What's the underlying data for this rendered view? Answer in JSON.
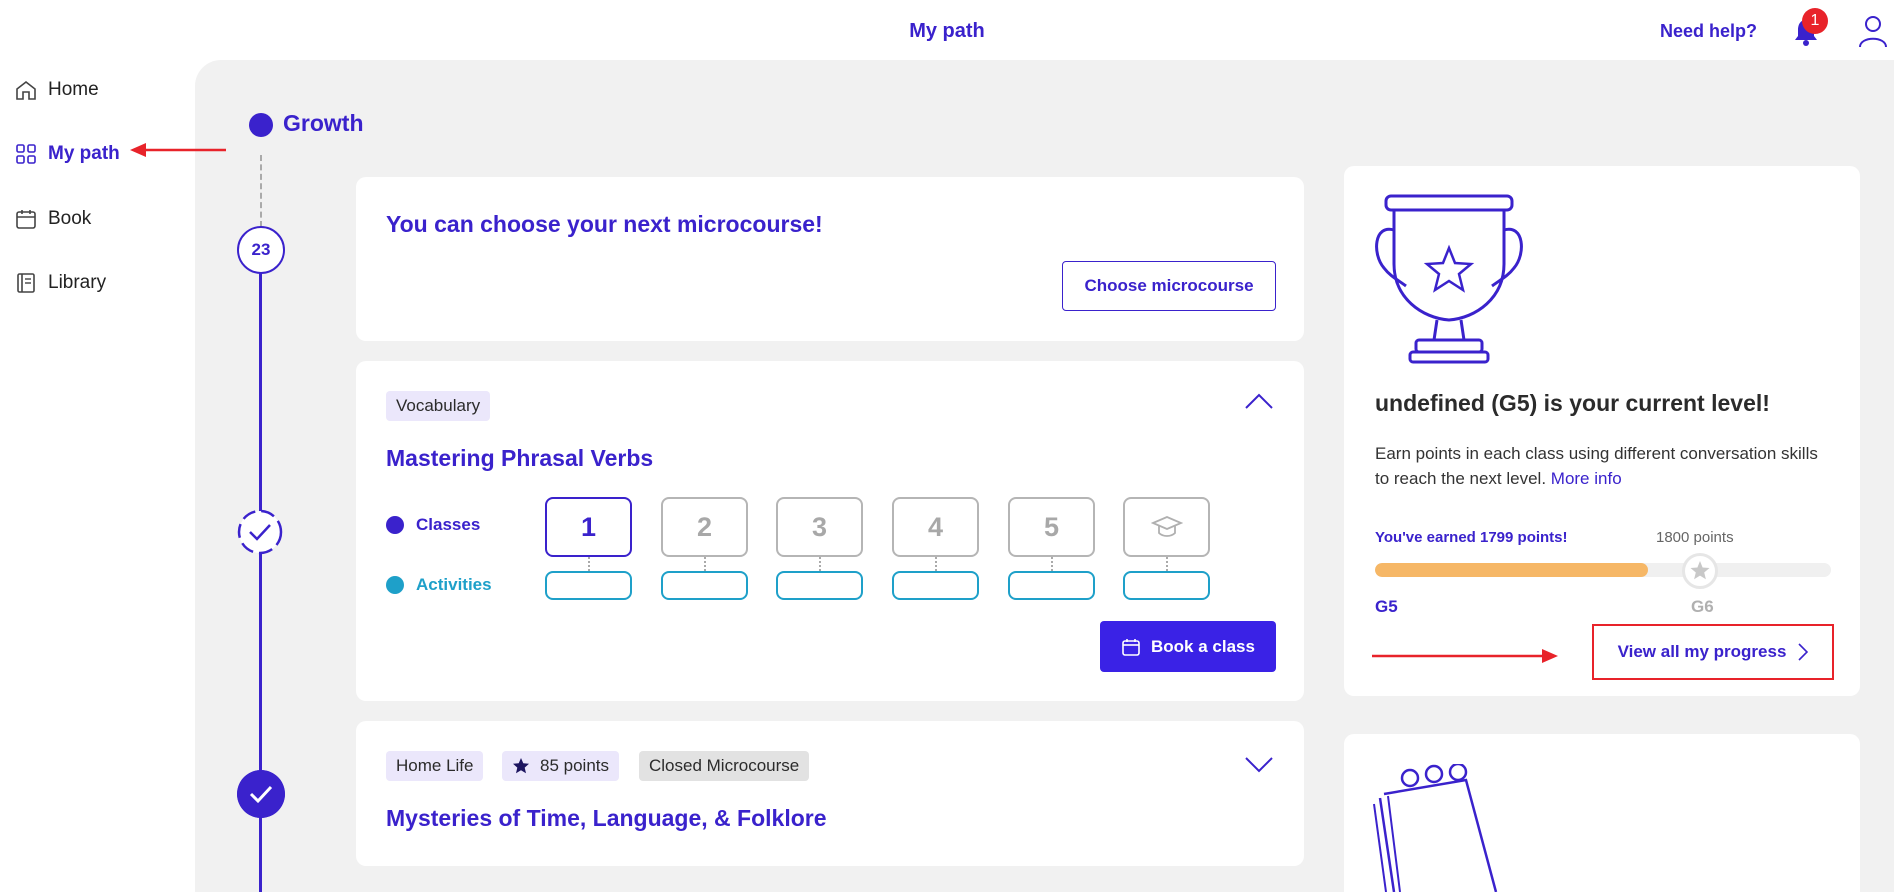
{
  "header": {
    "title": "My path",
    "help_label": "Need help?",
    "notification_count": "1"
  },
  "sidebar": {
    "items": [
      {
        "label": "Home",
        "icon": "home-icon"
      },
      {
        "label": "My path",
        "icon": "grid-icon",
        "active": true
      },
      {
        "label": "Book",
        "icon": "calendar-icon"
      },
      {
        "label": "Library",
        "icon": "book-icon"
      }
    ]
  },
  "path": {
    "section_label": "Growth",
    "step_number": "23"
  },
  "choose_card": {
    "title": "You can choose your next microcourse!",
    "button_label": "Choose microcourse"
  },
  "current_course": {
    "tag": "Vocabulary",
    "title": "Mastering Phrasal Verbs",
    "classes_label": "Classes",
    "activities_label": "Activities",
    "classes": [
      "1",
      "2",
      "3",
      "4",
      "5"
    ],
    "book_label": "Book a class"
  },
  "closed_course": {
    "tags": [
      "Home Life",
      "85 points",
      "Closed Microcourse"
    ],
    "title": "Mysteries of Time, Language, & Folklore"
  },
  "level_card": {
    "title": "undefined (G5) is your current level!",
    "description": "Earn points in each class using different conversation skills to reach the next level.",
    "more_info": "More info",
    "earned_label": "You've earned 1799 points!",
    "next_points": "1800 points",
    "current_level": "G5",
    "next_level": "G6",
    "progress_fraction": 0.999,
    "view_progress_label": "View all my progress"
  },
  "colors": {
    "brand": "#3a22cc",
    "button": "#3a22e6",
    "activity": "#1ea0c9",
    "progress": "#f6b766",
    "annotation": "#e8232a",
    "background": "#f1f1f1"
  }
}
